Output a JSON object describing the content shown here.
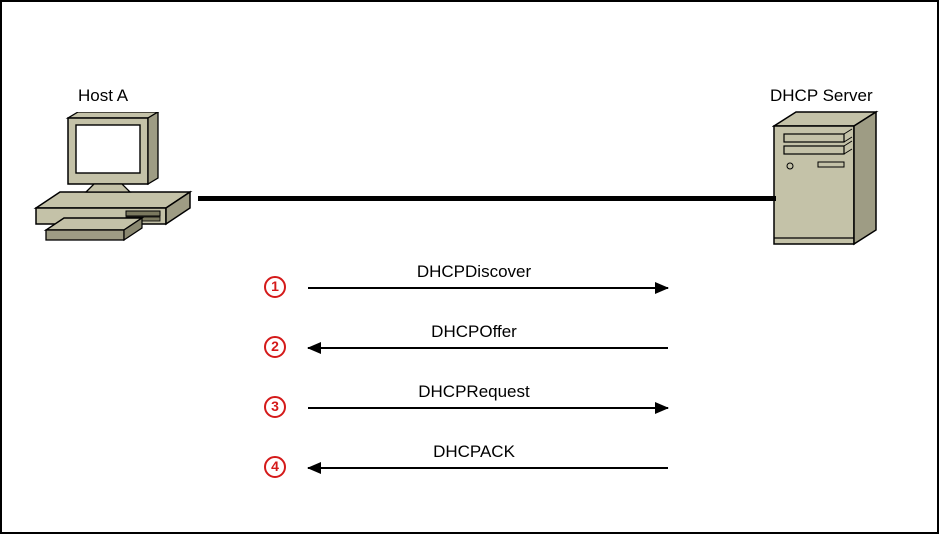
{
  "nodes": {
    "host_label": "Host A",
    "server_label": "DHCP Server"
  },
  "steps": [
    {
      "num": "1",
      "label": "DHCPDiscover",
      "direction": "right"
    },
    {
      "num": "2",
      "label": "DHCPOffer",
      "direction": "left"
    },
    {
      "num": "3",
      "label": "DHCPRequest",
      "direction": "right"
    },
    {
      "num": "4",
      "label": "DHCPACK",
      "direction": "left"
    }
  ]
}
